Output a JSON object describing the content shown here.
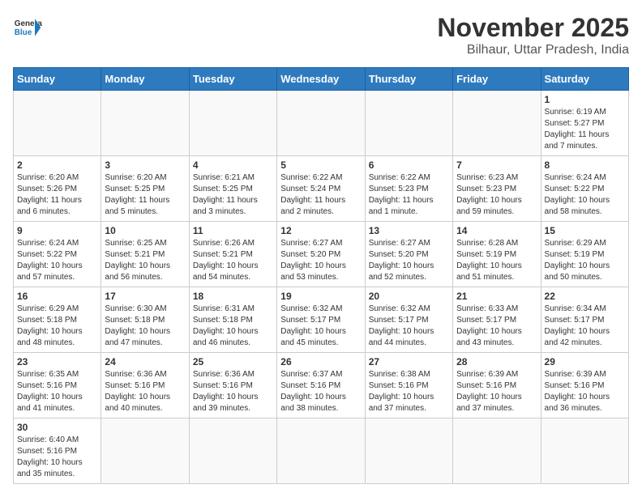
{
  "header": {
    "logo_general": "General",
    "logo_blue": "Blue",
    "month": "November 2025",
    "location": "Bilhaur, Uttar Pradesh, India"
  },
  "weekdays": [
    "Sunday",
    "Monday",
    "Tuesday",
    "Wednesday",
    "Thursday",
    "Friday",
    "Saturday"
  ],
  "weeks": [
    [
      {
        "day": "",
        "info": ""
      },
      {
        "day": "",
        "info": ""
      },
      {
        "day": "",
        "info": ""
      },
      {
        "day": "",
        "info": ""
      },
      {
        "day": "",
        "info": ""
      },
      {
        "day": "",
        "info": ""
      },
      {
        "day": "1",
        "info": "Sunrise: 6:19 AM\nSunset: 5:27 PM\nDaylight: 11 hours\nand 7 minutes."
      }
    ],
    [
      {
        "day": "2",
        "info": "Sunrise: 6:20 AM\nSunset: 5:26 PM\nDaylight: 11 hours\nand 6 minutes."
      },
      {
        "day": "3",
        "info": "Sunrise: 6:20 AM\nSunset: 5:25 PM\nDaylight: 11 hours\nand 5 minutes."
      },
      {
        "day": "4",
        "info": "Sunrise: 6:21 AM\nSunset: 5:25 PM\nDaylight: 11 hours\nand 3 minutes."
      },
      {
        "day": "5",
        "info": "Sunrise: 6:22 AM\nSunset: 5:24 PM\nDaylight: 11 hours\nand 2 minutes."
      },
      {
        "day": "6",
        "info": "Sunrise: 6:22 AM\nSunset: 5:23 PM\nDaylight: 11 hours\nand 1 minute."
      },
      {
        "day": "7",
        "info": "Sunrise: 6:23 AM\nSunset: 5:23 PM\nDaylight: 10 hours\nand 59 minutes."
      },
      {
        "day": "8",
        "info": "Sunrise: 6:24 AM\nSunset: 5:22 PM\nDaylight: 10 hours\nand 58 minutes."
      }
    ],
    [
      {
        "day": "9",
        "info": "Sunrise: 6:24 AM\nSunset: 5:22 PM\nDaylight: 10 hours\nand 57 minutes."
      },
      {
        "day": "10",
        "info": "Sunrise: 6:25 AM\nSunset: 5:21 PM\nDaylight: 10 hours\nand 56 minutes."
      },
      {
        "day": "11",
        "info": "Sunrise: 6:26 AM\nSunset: 5:21 PM\nDaylight: 10 hours\nand 54 minutes."
      },
      {
        "day": "12",
        "info": "Sunrise: 6:27 AM\nSunset: 5:20 PM\nDaylight: 10 hours\nand 53 minutes."
      },
      {
        "day": "13",
        "info": "Sunrise: 6:27 AM\nSunset: 5:20 PM\nDaylight: 10 hours\nand 52 minutes."
      },
      {
        "day": "14",
        "info": "Sunrise: 6:28 AM\nSunset: 5:19 PM\nDaylight: 10 hours\nand 51 minutes."
      },
      {
        "day": "15",
        "info": "Sunrise: 6:29 AM\nSunset: 5:19 PM\nDaylight: 10 hours\nand 50 minutes."
      }
    ],
    [
      {
        "day": "16",
        "info": "Sunrise: 6:29 AM\nSunset: 5:18 PM\nDaylight: 10 hours\nand 48 minutes."
      },
      {
        "day": "17",
        "info": "Sunrise: 6:30 AM\nSunset: 5:18 PM\nDaylight: 10 hours\nand 47 minutes."
      },
      {
        "day": "18",
        "info": "Sunrise: 6:31 AM\nSunset: 5:18 PM\nDaylight: 10 hours\nand 46 minutes."
      },
      {
        "day": "19",
        "info": "Sunrise: 6:32 AM\nSunset: 5:17 PM\nDaylight: 10 hours\nand 45 minutes."
      },
      {
        "day": "20",
        "info": "Sunrise: 6:32 AM\nSunset: 5:17 PM\nDaylight: 10 hours\nand 44 minutes."
      },
      {
        "day": "21",
        "info": "Sunrise: 6:33 AM\nSunset: 5:17 PM\nDaylight: 10 hours\nand 43 minutes."
      },
      {
        "day": "22",
        "info": "Sunrise: 6:34 AM\nSunset: 5:17 PM\nDaylight: 10 hours\nand 42 minutes."
      }
    ],
    [
      {
        "day": "23",
        "info": "Sunrise: 6:35 AM\nSunset: 5:16 PM\nDaylight: 10 hours\nand 41 minutes."
      },
      {
        "day": "24",
        "info": "Sunrise: 6:36 AM\nSunset: 5:16 PM\nDaylight: 10 hours\nand 40 minutes."
      },
      {
        "day": "25",
        "info": "Sunrise: 6:36 AM\nSunset: 5:16 PM\nDaylight: 10 hours\nand 39 minutes."
      },
      {
        "day": "26",
        "info": "Sunrise: 6:37 AM\nSunset: 5:16 PM\nDaylight: 10 hours\nand 38 minutes."
      },
      {
        "day": "27",
        "info": "Sunrise: 6:38 AM\nSunset: 5:16 PM\nDaylight: 10 hours\nand 37 minutes."
      },
      {
        "day": "28",
        "info": "Sunrise: 6:39 AM\nSunset: 5:16 PM\nDaylight: 10 hours\nand 37 minutes."
      },
      {
        "day": "29",
        "info": "Sunrise: 6:39 AM\nSunset: 5:16 PM\nDaylight: 10 hours\nand 36 minutes."
      }
    ],
    [
      {
        "day": "30",
        "info": "Sunrise: 6:40 AM\nSunset: 5:16 PM\nDaylight: 10 hours\nand 35 minutes."
      },
      {
        "day": "",
        "info": ""
      },
      {
        "day": "",
        "info": ""
      },
      {
        "day": "",
        "info": ""
      },
      {
        "day": "",
        "info": ""
      },
      {
        "day": "",
        "info": ""
      },
      {
        "day": "",
        "info": ""
      }
    ]
  ]
}
